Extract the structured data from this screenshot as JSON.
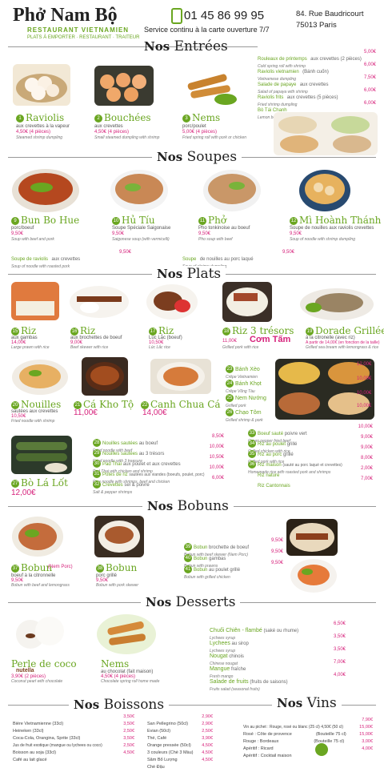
{
  "header": {
    "title": "Phở Nam Bộ",
    "subtitle": "RESTAURANT VIETNAMIEN",
    "services": "PLATS À EMPORTER · RESTAURANT · TRAITEUR",
    "phone": "01 45 86 99 95",
    "service_line": "Service continu à la carte ouverture 7/7",
    "address1": "84. Rue Baudricourt",
    "address2": "75013 Paris"
  },
  "sections": {
    "entrees": {
      "nos": "Nos",
      "title": "Entrées"
    },
    "soupes": {
      "nos": "Nos",
      "title": "Soupes"
    },
    "plats": {
      "nos": "Nos",
      "title": "Plats"
    },
    "bobuns": {
      "nos": "Nos",
      "title": "Bobuns"
    },
    "desserts": {
      "nos": "Nos",
      "title": "Desserts"
    },
    "boissons": {
      "nos": "Nos",
      "title": "Boissons"
    },
    "vins": {
      "nos": "Nos",
      "title": "Vins"
    }
  },
  "entrees": {
    "featured": [
      {
        "num": "1",
        "name": "Raviolis",
        "desc": "aux crevettes à la vapeur",
        "price": "4,50€ (4 pièces)",
        "eng": "Steamed shrimp dumpling"
      },
      {
        "num": "2",
        "name": "Bouchées",
        "desc": "aux crevettes",
        "price": "4,50€ (4 pièces)",
        "eng": "Small steamed dumpling with shrimp"
      },
      {
        "num": "3",
        "name": "Nems",
        "desc": "porc/poulet",
        "price": "5,00€ (4 pièces)",
        "eng": "Fried spring roll with pork or chicken"
      }
    ],
    "list": [
      {
        "num": "4",
        "name": "Rouleaux de printemps",
        "extra": "aux crevettes (2 pièces)",
        "eng": "Cold spring roll with shrimp",
        "price": "5,00€"
      },
      {
        "num": "5",
        "name": "Raviolis vietnamien",
        "extra": "(Bánh cuốn)",
        "eng": "Vietnamese dumpling",
        "price": "6,00€"
      },
      {
        "num": "6",
        "name": "Salade de papaye",
        "extra": "aux crevettes",
        "eng": "Salad of papaya with shrimp",
        "price": "7,50€"
      },
      {
        "num": "7",
        "name": "Raviolis frits",
        "extra": "aux crevettes (5 pièces)",
        "eng": "Fried shrimp dumpling",
        "price": "6,00€"
      },
      {
        "num": "8",
        "name": "Bò Tái Chanh",
        "extra": "",
        "eng": "Lemon beef",
        "price": "6,00€"
      }
    ]
  },
  "soupes": {
    "featured": [
      {
        "num": "9",
        "name": "Bun Bo Hue",
        "desc": "porc/boeuf",
        "price": "9,50€",
        "eng": "Soup with beef and pork"
      },
      {
        "num": "10",
        "name": "Hủ Tíu",
        "desc": "Soupe Spéciale Saigonaise",
        "price": "9,50€",
        "eng": "Saigonese soup (with vermicelli)"
      },
      {
        "num": "11",
        "name": "Phở",
        "desc": "Pho tonkinoise au boeuf",
        "price": "9,50€",
        "eng": "Pho soup with beef"
      },
      {
        "num": "12",
        "name": "Mì Hoành Thánh",
        "desc": "Soupe de nouilles aux raviolis crevettes",
        "price": "9,50€",
        "eng": "Soup of noodle with shrimp dumpling"
      }
    ],
    "list": [
      {
        "num": "13",
        "name": "Soupe de raviolis",
        "extra": "aux crevettes",
        "eng": "Soup of noodle with roasted pork",
        "price": "9,50€"
      },
      {
        "num": "14",
        "name": "Soupe",
        "extra": "de nouilles au porc laqué",
        "eng": "Soup of shrimp dumpling",
        "price": "9,50€"
      }
    ]
  },
  "plats": {
    "row1": [
      {
        "num": "15",
        "name": "Riz",
        "desc": "aux gambas",
        "price": "14,00€",
        "eng": "Large prawn with rice"
      },
      {
        "num": "16",
        "name": "Riz",
        "desc": "aux brochettes de boeuf",
        "price": "9,00€",
        "eng": "Beef skewer with rice"
      },
      {
        "num": "17",
        "name": "Riz",
        "desc": "Lúc Lắc (boeuf)",
        "price": "10,50€",
        "eng": "Lúc Lắc rice"
      },
      {
        "num": "18",
        "name": "Riz 3 trésors",
        "desc": "",
        "price": "11,00€",
        "alt": "Cơm Tấm",
        "eng": "Grilled pork with rice"
      },
      {
        "num": "19",
        "name": "Dorade Grillée",
        "desc": "à la citronelle (avec riz)",
        "price": "A partir de 14,00€ (en fonction de la taille)",
        "eng": "Grilled sea bream with lemongrass & rice"
      }
    ],
    "row2": [
      {
        "num": "20",
        "name": "Nouilles",
        "desc": "sautées aux crevettes",
        "price": "10,50€",
        "eng": "Fried noodle with shrimp"
      },
      {
        "num": "21",
        "name": "Cá Kho Tộ",
        "price": "11,00€"
      },
      {
        "num": "22",
        "name": "Canh Chua Cá",
        "price": "14,00€"
      }
    ],
    "crepes": [
      {
        "num": "23",
        "name": "Bánh Xèo",
        "eng": "Crêpe Vietnamien",
        "price": "12,00€"
      },
      {
        "num": "24",
        "name": "Bánh Khọt",
        "eng": "Crêpe Vũng Tàu",
        "price": "10,00€"
      },
      {
        "num": "25",
        "name": "Nem Nướng",
        "eng": "Grilled pork",
        "price": "10,00€"
      },
      {
        "num": "26",
        "name": "Chạo Tôm",
        "eng": "Grilled shrimp & pork",
        "price": "10,00€"
      }
    ],
    "bo_la_lot": {
      "num": "27",
      "name": "Bò Lá Lốt",
      "price": "12,00€"
    },
    "list_mid": [
      {
        "num": "28",
        "name": "Nouilles sautées",
        "extra": "au boeuf",
        "eng": "Fried noodle with beef",
        "price": "8,50€"
      },
      {
        "num": "29",
        "name": "Nouilles sautées",
        "extra": "au 3 trésors",
        "eng": "Fried noodle with 3 treasure",
        "price": "10,00€"
      },
      {
        "num": "30",
        "name": "Pad Thaï",
        "extra": "aux poulet et aux crevettes",
        "eng": "Pad Thai with chicken and shrimp",
        "price": "10,50€"
      },
      {
        "num": "31",
        "name": "Potes de riz",
        "extra": "sautées aux viandes (boeufs, poulet, porc)",
        "eng": "Rice noodle with shrimps, beef and chicken",
        "price": "10,00€"
      },
      {
        "num": "32",
        "name": "Crevettes",
        "extra": "sel & poivre",
        "eng": "Salt & pepper shrimps",
        "price": "6,00€"
      }
    ],
    "list_right": [
      {
        "num": "33",
        "name": "Boeuf sauté",
        "extra": "poivre vert",
        "eng": "Green pepper fried beef",
        "price": "10,00€"
      },
      {
        "num": "34",
        "name": "Riz au poulet",
        "extra": "grillé",
        "eng": "Grilled chicken with rice",
        "price": "9,00€"
      },
      {
        "num": "35",
        "name": "Riz au porc",
        "extra": "grillé",
        "eng": "Grilled pork with rice",
        "price": "9,00€"
      },
      {
        "num": "36",
        "name": "Riz maison",
        "extra": "(sauté au porc laqué et crevettes)",
        "eng": "Homemade rice with roasted pork and shrimps",
        "price": "8,00€"
      },
      {
        "num": "",
        "name": "Riz nature",
        "extra": "",
        "eng": "",
        "price": "2,00€"
      },
      {
        "num": "",
        "name": "Riz Cantonnais",
        "extra": "",
        "eng": "",
        "price": "7,00€"
      }
    ]
  },
  "bobuns": {
    "featured": [
      {
        "num": "37",
        "name": "Bobun",
        "alt": "(Nem Porc)",
        "desc": "boeuf à la citronnelle",
        "price": "9,50€",
        "eng": "Bobun with beef and lemongrass"
      },
      {
        "num": "38",
        "name": "Bobun",
        "alt": "",
        "desc": "porc grillé",
        "price": "9,50€",
        "eng": "Bobun with pork skewer"
      }
    ],
    "list": [
      {
        "num": "39",
        "name": "Bobun",
        "extra": "brochette de boeuf",
        "eng": "Bobun with beef skewer (Nem Porc)",
        "price": "9,50€"
      },
      {
        "num": "40",
        "name": "Bobun",
        "extra": "gambas",
        "eng": "Bobun with prawns",
        "price": "9,50€"
      },
      {
        "num": "41",
        "name": "Bobun",
        "extra": "au poulet grillé",
        "eng": "Bobun with grilled chicken",
        "price": "9,50€"
      }
    ]
  },
  "desserts": {
    "featured": [
      {
        "name": "Perle de coco",
        "alt": "nutella",
        "price": "3,90€ (2 pièces)",
        "eng": "Coconut pearl with chocolate"
      },
      {
        "name": "Nems",
        "alt": "",
        "desc": "au chocolat (fait maison)",
        "price": "4,50€ (4 pièces)",
        "eng": "Chocolate spring roll home made"
      }
    ],
    "list": [
      {
        "name": "Chuối Chiên - flambé",
        "extra": "(saké ou rhume)",
        "eng": "Lychees syrup",
        "price": "6,50€"
      },
      {
        "name": "Lychees",
        "extra": "au sirop",
        "eng": "Lychees syrup",
        "price": "3,50€"
      },
      {
        "name": "Nougat",
        "extra": "chinois",
        "eng": "Chinese nougat",
        "price": "3,50€"
      },
      {
        "name": "Mangue",
        "extra": "fraîche",
        "eng": "Fresh mango",
        "price": "7,00€"
      },
      {
        "name": "Salade de fruits",
        "extra": "(fruits de saisons)",
        "eng": "Fruits salad (seasonal fruits)",
        "price": "4,00€"
      }
    ]
  },
  "boissons": {
    "col1": [
      {
        "name": "Bière Vietnamienne (33cl)",
        "price": "3,50€"
      },
      {
        "name": "Heineken (33cl)",
        "price": "3,50€"
      },
      {
        "name": "Coca-Cola, Orangina, Sprite (33cl)",
        "price": "2,50€"
      },
      {
        "name": "Jus de fruit exotique (mangue ou lychees ou coco)",
        "price": "3,50€"
      },
      {
        "name": "Boisson au soja (33cl)",
        "price": "2,50€"
      },
      {
        "name": "Café au lait glacé",
        "price": "4,50€"
      }
    ],
    "col2": [
      {
        "name": "San Pellegrino (50cl)",
        "price": "2,90€"
      },
      {
        "name": "Evian (50cl)",
        "price": "2,90€"
      },
      {
        "name": "Thé, Café",
        "price": "2,50€"
      },
      {
        "name": "Orange pressée (50cl)",
        "price": "3,90€"
      },
      {
        "name": "3 couleurs (Chè 3 Màu)",
        "price": "4,50€"
      },
      {
        "name": "Sâm Bổ Lượng",
        "price": "4,50€"
      },
      {
        "name": "Chè Đậu",
        "price": "4,50€"
      }
    ]
  },
  "vins": {
    "list": [
      {
        "name": "Vin au pichet : Rouge, rosé ou blanc (25 cl) 4,50€ (50 cl)",
        "price": "7,90€"
      },
      {
        "name": "Rosé : Côte de provence",
        "extra": "(Bouteille 75 cl)",
        "price": "15,00€"
      },
      {
        "name": "Rouge : Bordeaux",
        "extra": "(Bouteille 75 cl)",
        "price": "15,00€"
      },
      {
        "name": "Apéritif : Ricard",
        "extra": "",
        "price": "3,00€"
      },
      {
        "name": "Apéritif : Cocktail maison",
        "extra": "",
        "price": "4,00€"
      }
    ]
  },
  "colors": {
    "accent": "#6aa621",
    "price": "#d6217b"
  }
}
